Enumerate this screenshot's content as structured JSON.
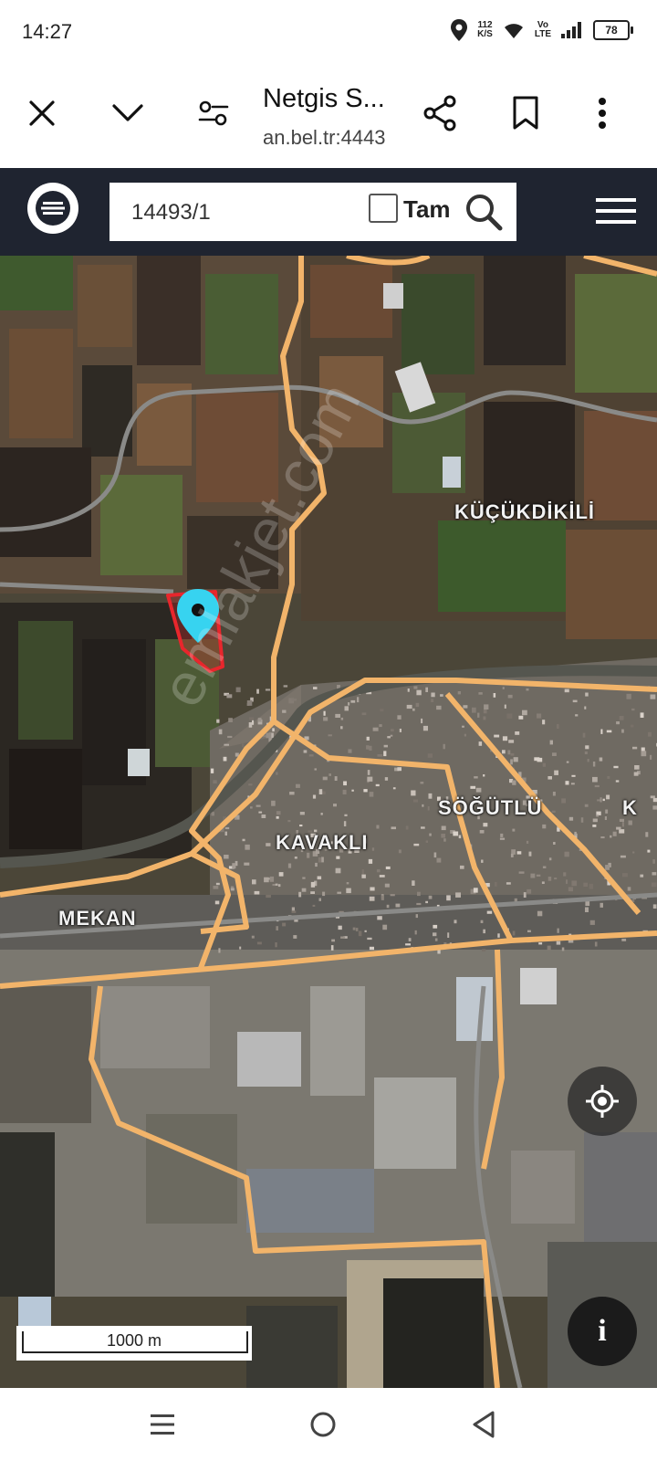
{
  "status_bar": {
    "time": "14:27",
    "net_speed_value": "112",
    "net_speed_unit": "K/S",
    "volte_top": "Vo",
    "volte_bottom": "LTE",
    "battery": "78",
    "icons": [
      "location-icon",
      "wifi-icon",
      "signal-icon",
      "battery-icon"
    ]
  },
  "browser": {
    "title": "Netgis S...",
    "url": "an.bel.tr:4443",
    "icons": [
      "close-icon",
      "chevron-down-icon",
      "site-settings-icon",
      "share-icon",
      "bookmark-icon",
      "more-vert-icon"
    ]
  },
  "toolbar": {
    "search_value": "14493/1",
    "tam_label": "Tam",
    "tam_checked": false,
    "icons": [
      "layers-icon",
      "search-icon",
      "hamburger-menu-icon"
    ]
  },
  "map": {
    "place_labels": [
      "KÜÇÜKDİKİLİ",
      "SÖĞÜTLÜ",
      "KAVAKLI",
      "MEKAN",
      "K"
    ],
    "watermark": "emlakjet.com",
    "scale_label": "1000 m",
    "info_label": "i",
    "parcel_color": "#e8262c",
    "marker_color": "#37d3f0",
    "boundary_color": "#f2b46a"
  },
  "nav_bar": {
    "icons": [
      "recents-icon",
      "home-icon",
      "back-icon"
    ]
  }
}
